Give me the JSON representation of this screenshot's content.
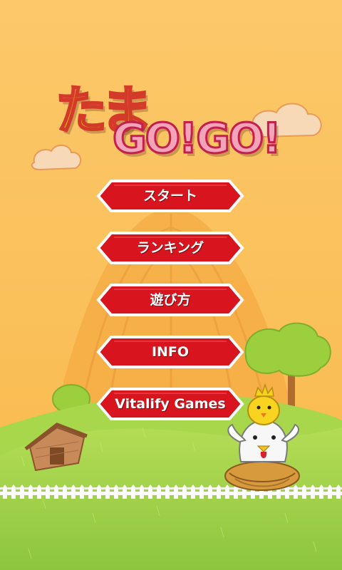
{
  "logo": {
    "line1": "たま",
    "line2": "GO!GO!"
  },
  "menu": [
    {
      "label": "スタート"
    },
    {
      "label": "ランキング"
    },
    {
      "label": "遊び方"
    },
    {
      "label": "INFO"
    },
    {
      "label": "Vitalify Games"
    }
  ],
  "icons": [
    "chick-with-crown",
    "hen-in-nest",
    "barn",
    "tree",
    "cloud",
    "haystack",
    "fence"
  ],
  "colors": {
    "sky": "#fcc25c",
    "grass": "#9fd14a",
    "button": "#d8151f",
    "button_border": "#ffffff"
  }
}
